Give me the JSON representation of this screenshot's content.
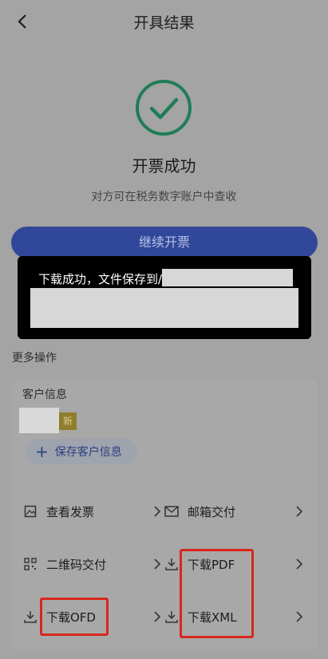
{
  "nav": {
    "title": "开具结果"
  },
  "result": {
    "title": "开票成功",
    "subtitle": "对方可在税务数字账户中查收",
    "accent": "#1f8a5f"
  },
  "primary_button": {
    "label": "继续开票",
    "color": "#31489a"
  },
  "toast": {
    "message": "下载成功，文件保存到/"
  },
  "more": {
    "label": "更多操作",
    "customer": {
      "label": "客户信息",
      "badge": "新",
      "save_label": "保存客户信息"
    },
    "actions": [
      {
        "label": "查看发票",
        "icon": "image-icon"
      },
      {
        "label": "邮箱交付",
        "icon": "mail-icon"
      },
      {
        "label": "二维码交付",
        "icon": "qrcode-icon"
      },
      {
        "label": "下载PDF",
        "icon": "download-icon"
      },
      {
        "label": "下载OFD",
        "icon": "download-icon"
      },
      {
        "label": "下载XML",
        "icon": "download-icon"
      }
    ]
  },
  "highlight_color": "#d9261c"
}
